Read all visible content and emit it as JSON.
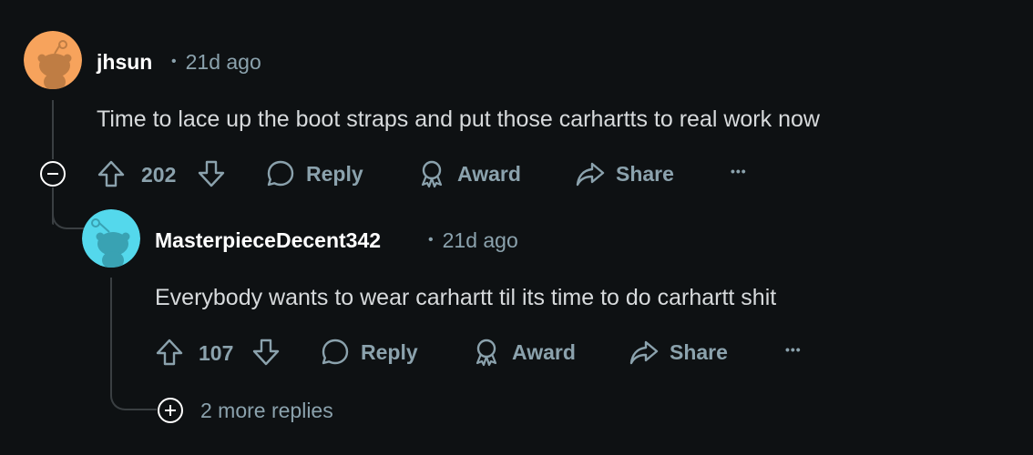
{
  "comments": [
    {
      "username": "jhsun",
      "time": "21d ago",
      "body": "Time to lace up the boot straps and put those carhartts to real work now",
      "votes": "202",
      "avatar_color": "#f7a35c",
      "reply_label": "Reply",
      "award_label": "Award",
      "share_label": "Share",
      "more_label": "•••"
    },
    {
      "username": "MasterpieceDecent342",
      "time": "21d ago",
      "body": "Everybody wants to wear carhartt til its time to do carhartt shit",
      "votes": "107",
      "avatar_color": "#54d8ec",
      "reply_label": "Reply",
      "award_label": "Award",
      "share_label": "Share",
      "more_label": "•••"
    }
  ],
  "more_replies": "2 more replies",
  "meta_separator": "•",
  "colors": {
    "background": "#0e1113",
    "muted": "#8ba2ad",
    "text": "#d7dadc",
    "line": "#3a3f42"
  }
}
